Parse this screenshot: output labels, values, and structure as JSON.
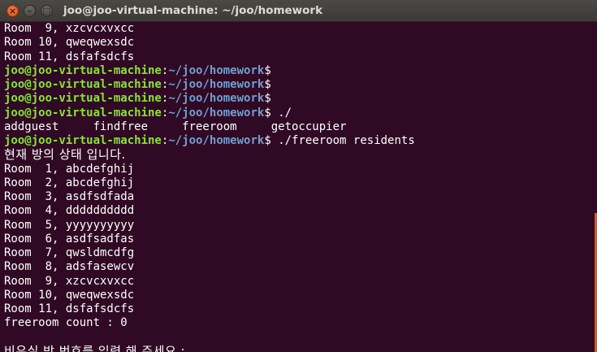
{
  "window": {
    "title": "joo@joo-virtual-machine: ~/joo/homework",
    "close_glyph": "×",
    "minimize_glyph": "–",
    "maximize_glyph": "□"
  },
  "scrollbar": {
    "color": "#e2571e",
    "thumb_start_fraction": 0.58,
    "thumb_end_fraction": 1.0
  },
  "colors": {
    "background": "#300a24",
    "prompt_user": "#8ae234",
    "prompt_path": "#729fcf",
    "text": "#ffffff"
  },
  "terminal": {
    "prompt_user": "joo@joo-virtual-machine",
    "prompt_sep": ":",
    "prompt_path": "~/joo/homework",
    "prompt_end": "$",
    "lines": [
      {
        "type": "text",
        "text": "Room  9, xzcvcxvxcc"
      },
      {
        "type": "text",
        "text": "Room 10, qweqwexsdc"
      },
      {
        "type": "text",
        "text": "Room 11, dsfafsdcfs"
      },
      {
        "type": "prompt",
        "cmd": ""
      },
      {
        "type": "prompt",
        "cmd": ""
      },
      {
        "type": "prompt",
        "cmd": ""
      },
      {
        "type": "prompt",
        "cmd": " ./"
      },
      {
        "type": "text",
        "text": "addguest     findfree     freeroom     getoccupier"
      },
      {
        "type": "prompt",
        "cmd": " ./freeroom residents"
      },
      {
        "type": "korean",
        "text": "현재 방의 상태 입니다."
      },
      {
        "type": "text",
        "text": "Room  1, abcdefghij"
      },
      {
        "type": "text",
        "text": "Room  2, abcdefghij"
      },
      {
        "type": "text",
        "text": "Room  3, asdfsdfada"
      },
      {
        "type": "text",
        "text": "Room  4, dddddddddd"
      },
      {
        "type": "text",
        "text": "Room  5, yyyyyyyyyy"
      },
      {
        "type": "text",
        "text": "Room  6, asdfsadfas"
      },
      {
        "type": "text",
        "text": "Room  7, qwsldmcdfg"
      },
      {
        "type": "text",
        "text": "Room  8, adsfasewcv"
      },
      {
        "type": "text",
        "text": "Room  9, xzcvcxvxcc"
      },
      {
        "type": "text",
        "text": "Room 10, qweqwexsdc"
      },
      {
        "type": "text",
        "text": "Room 11, dsfafsdcfs"
      },
      {
        "type": "text",
        "text": "freeroom count : 0"
      },
      {
        "type": "text",
        "text": ""
      },
      {
        "type": "korean",
        "text": "비우실 방 번호를 입력 해 주세요 :"
      }
    ]
  }
}
